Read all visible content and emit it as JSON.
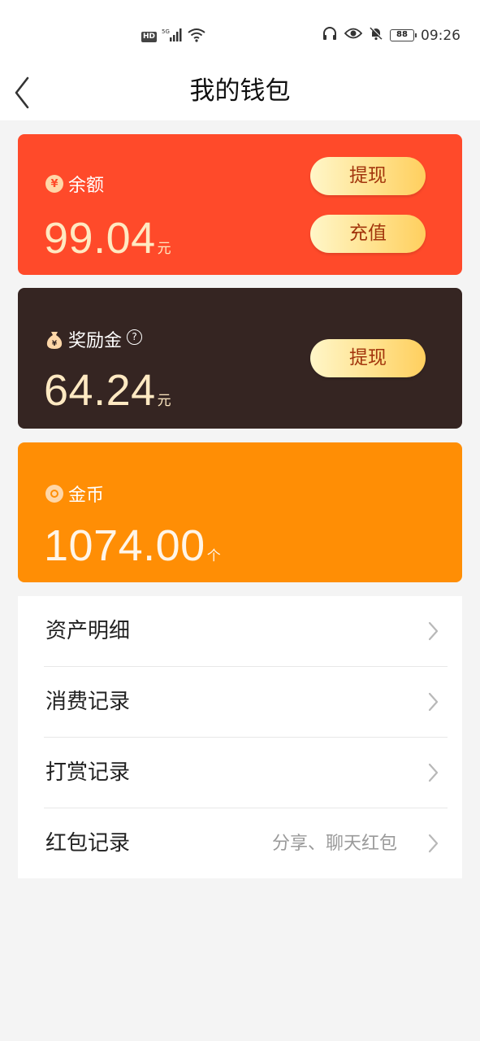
{
  "status_bar": {
    "left_badge": "HD",
    "network": "5G",
    "battery": "88",
    "time": "09:26"
  },
  "nav": {
    "title": "我的钱包"
  },
  "balance_card": {
    "label": "余额",
    "icon": "yen-icon",
    "amount": "99.04",
    "unit": "元",
    "withdraw_label": "提现",
    "recharge_label": "充值",
    "color": "#ff4a2a"
  },
  "reward_card": {
    "label": "奖励金",
    "icon": "money-bag-icon",
    "amount": "64.24",
    "unit": "元",
    "withdraw_label": "提现",
    "color": "#352522"
  },
  "coin_card": {
    "label": "金币",
    "icon": "coin-icon",
    "amount": "1074.00",
    "unit": "个",
    "color": "#ff8e05"
  },
  "menu": {
    "items": [
      {
        "label": "资产明细",
        "hint": ""
      },
      {
        "label": "消费记录",
        "hint": ""
      },
      {
        "label": "打赏记录",
        "hint": ""
      },
      {
        "label": "红包记录",
        "hint": "分享、聊天红包"
      }
    ]
  }
}
